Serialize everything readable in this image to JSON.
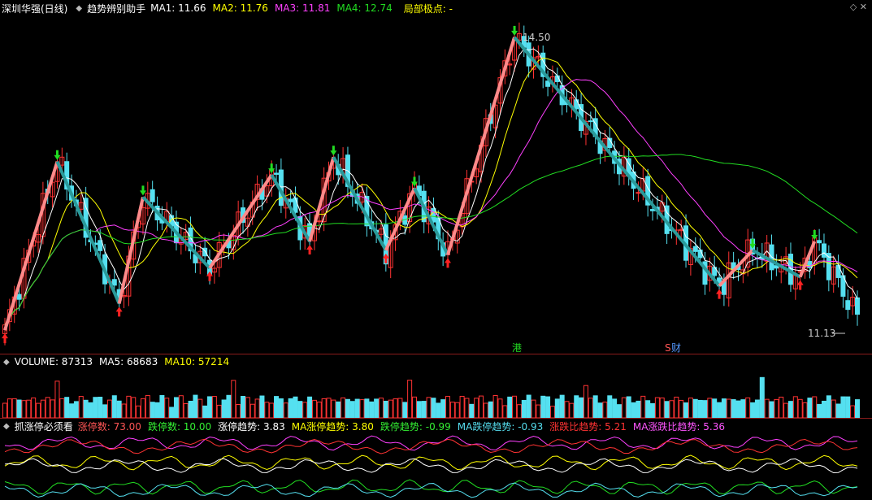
{
  "main": {
    "title": "深圳华强(日线)",
    "indicator": "趋势辨别助手",
    "ma": [
      {
        "label": "MA1:",
        "value": "11.66",
        "color": "#ffffff"
      },
      {
        "label": "MA2:",
        "value": "11.76",
        "color": "#ffff00"
      },
      {
        "label": "MA3:",
        "value": "11.81",
        "color": "#ff40ff"
      },
      {
        "label": "MA4:",
        "value": "12.74",
        "color": "#22dd22"
      }
    ],
    "extreme_label": "局部极点: -",
    "high_label": "14.50",
    "low_label": "11.13",
    "marker_hk": "港",
    "marker_cai": "财",
    "marker_s": "S"
  },
  "volume": {
    "items": [
      {
        "label": "VOLUME:",
        "value": "87313",
        "color": "#ffffff"
      },
      {
        "label": "MA5:",
        "value": "68683",
        "color": "#ffffff"
      },
      {
        "label": "MA10:",
        "value": "57214",
        "color": "#ffff00"
      }
    ]
  },
  "limit": {
    "title": "抓涨停必须看",
    "items": [
      {
        "label": "涨停数:",
        "value": "73.00",
        "color": "#ff5555"
      },
      {
        "label": "跌停数:",
        "value": "10.00",
        "color": "#33ee33"
      },
      {
        "label": "涨停趋势:",
        "value": "3.83",
        "color": "#ffffff"
      },
      {
        "label": "MA涨停趋势:",
        "value": "3.80",
        "color": "#ffff00"
      },
      {
        "label": "跌停趋势:",
        "value": "-0.99",
        "color": "#33ee33"
      },
      {
        "label": "MA跌停趋势:",
        "value": "-0.93",
        "color": "#55ddee"
      },
      {
        "label": "涨跌比趋势:",
        "value": "5.21",
        "color": "#ff3333"
      },
      {
        "label": "MA涨跌比趋势:",
        "value": "5.36",
        "color": "#ff55ff"
      }
    ]
  },
  "colors": {
    "up": "#ff3333",
    "down": "#55e0f0",
    "zig_up": "#ff8a8a",
    "zig_down": "#2a9a9a",
    "ma1": "#ffffff",
    "ma2": "#ffff00",
    "ma3": "#ff40ff",
    "ma4": "#22dd22",
    "border": "#8a1c1c"
  },
  "chart_data": {
    "type": "candlestick",
    "ylim": [
      11.0,
      14.7
    ],
    "zigzag": [
      {
        "i": 0,
        "price": 11.2
      },
      {
        "i": 11,
        "price": 13.1
      },
      {
        "i": 24,
        "price": 11.5
      },
      {
        "i": 29,
        "price": 12.7
      },
      {
        "i": 43,
        "price": 11.9
      },
      {
        "i": 56,
        "price": 12.95
      },
      {
        "i": 64,
        "price": 12.2
      },
      {
        "i": 69,
        "price": 13.15
      },
      {
        "i": 80,
        "price": 12.1
      },
      {
        "i": 86,
        "price": 12.8
      },
      {
        "i": 93,
        "price": 12.05
      },
      {
        "i": 107,
        "price": 14.5
      },
      {
        "i": 150,
        "price": 11.7
      },
      {
        "i": 157,
        "price": 12.1
      },
      {
        "i": 167,
        "price": 11.8
      },
      {
        "i": 170,
        "price": 12.2
      }
    ],
    "last_close": 11.13
  }
}
